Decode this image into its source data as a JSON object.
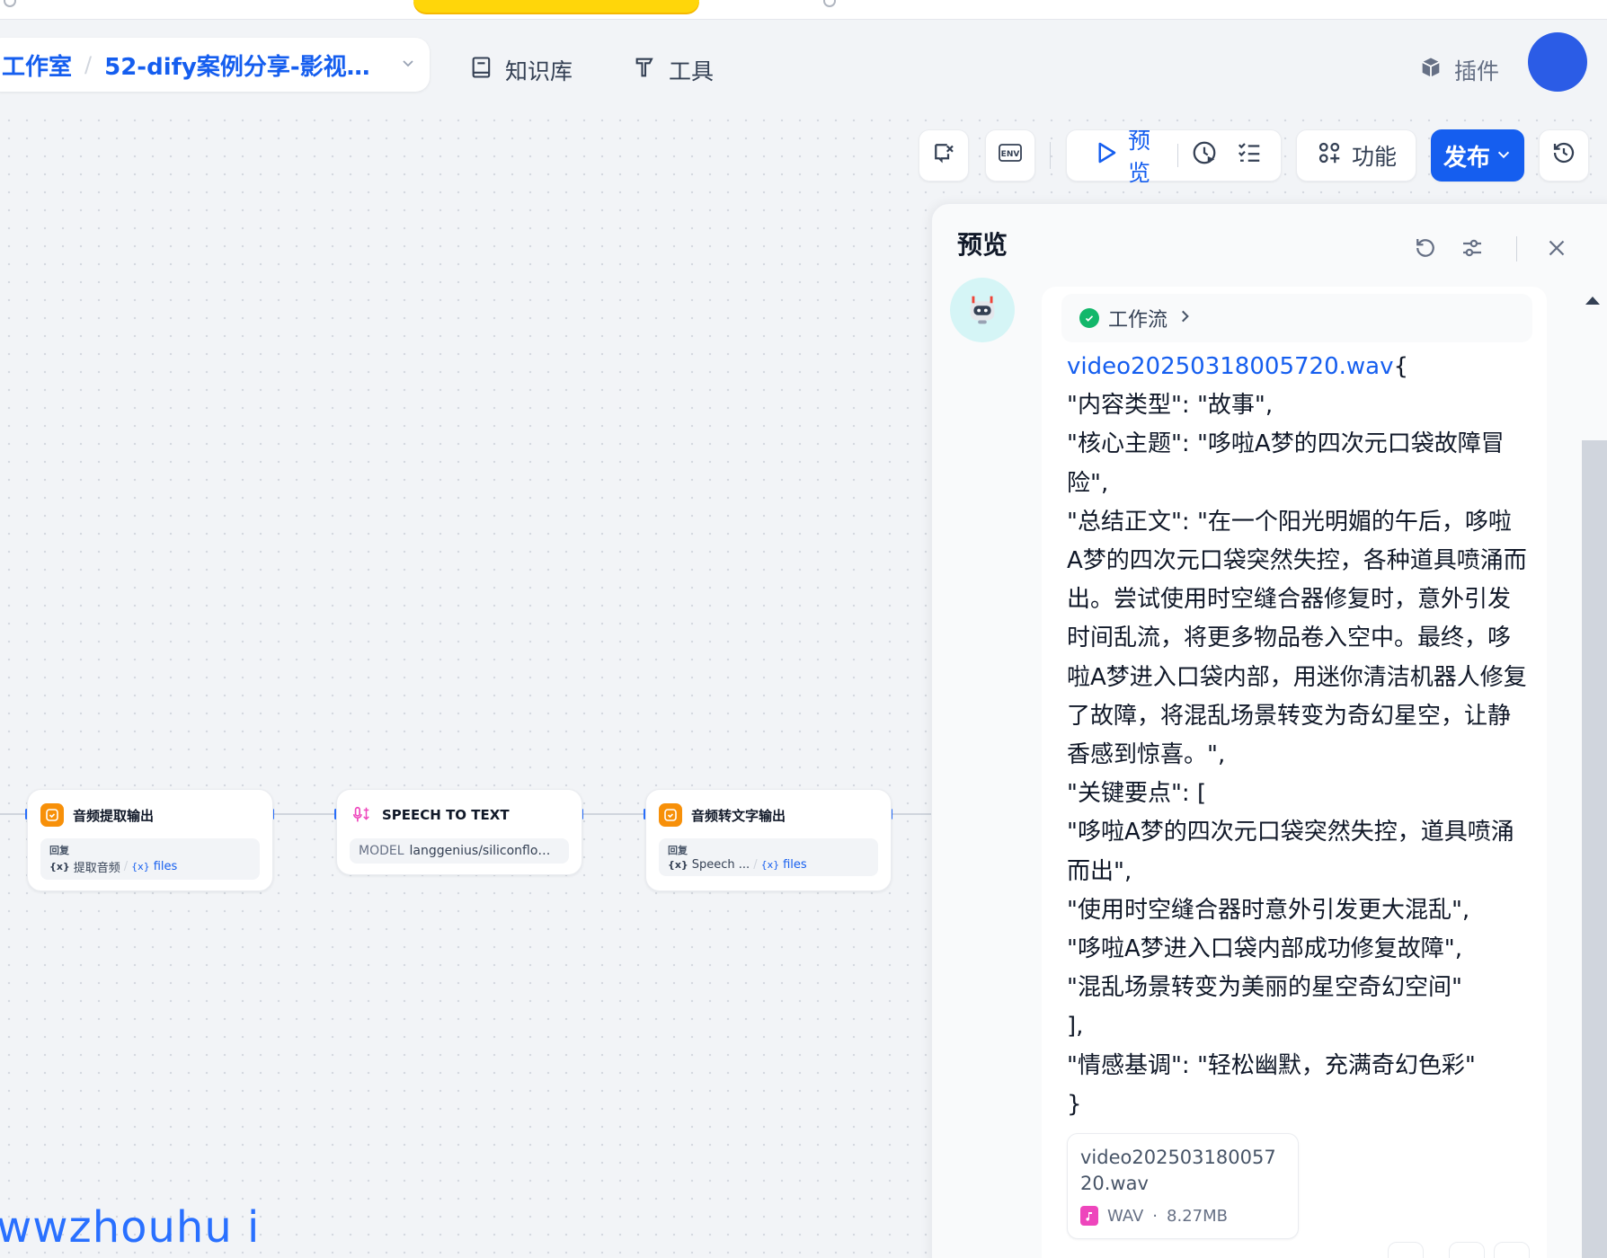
{
  "header": {
    "studio": "工作室",
    "app_name": "52-dify案例分享-影视频...",
    "knowledge": "知识库",
    "tools": "工具",
    "plugins": "插件"
  },
  "toolbar": {
    "preview": "预览",
    "features": "功能",
    "publish": "发布"
  },
  "nodes": [
    {
      "title": "音频提取输出",
      "label": "回复",
      "var1": "提取音频",
      "var2": "files"
    },
    {
      "title": "SPEECH TO TEXT",
      "model_key": "MODEL",
      "model_value": "langgenius/siliconflow/sili..."
    },
    {
      "title": "音频转文字输出",
      "label": "回复",
      "var1": "Speech ...",
      "var2": "files"
    }
  ],
  "panel": {
    "title": "预览",
    "workflow_chip": "工作流",
    "filename_link": "video20250318005720.wav",
    "lines": [
      "\"内容类型\": \"故事\",",
      "\"核心主题\": \"哆啦A梦的四次元口袋故障冒险\",",
      "\"总结正文\": \"在一个阳光明媚的午后，哆啦A梦的四次元口袋突然失控，各种道具喷涌而出。尝试使用时空缝合器修复时，意外引发时间乱流，将更多物品卷入空中。最终，哆啦A梦进入口袋内部，用迷你清洁机器人修复了故障，将混乱场景转变为奇幻星空，让静香感到惊喜。\",",
      "\"关键要点\": [",
      "\"哆啦A梦的四次元口袋突然失控，道具喷涌而出\",",
      "\"使用时空缝合器时意外引发更大混乱\",",
      "\"哆啦A梦进入口袋内部成功修复故障\",",
      "\"混乱场景转变为美丽的星空奇幻空间\"",
      "],",
      "\"情感基调\": \"轻松幽默，充满奇幻色彩\"",
      "}"
    ],
    "file_card": {
      "name": "video20250318005720.wav",
      "type": "WAV",
      "sep": "·",
      "size": "8.27MB"
    }
  },
  "watermark": "wwzhouhu i",
  "colors": {
    "accent": "#155eef",
    "node_icon": "#f79009",
    "success": "#12b76a",
    "audio": "#ee46bc"
  }
}
